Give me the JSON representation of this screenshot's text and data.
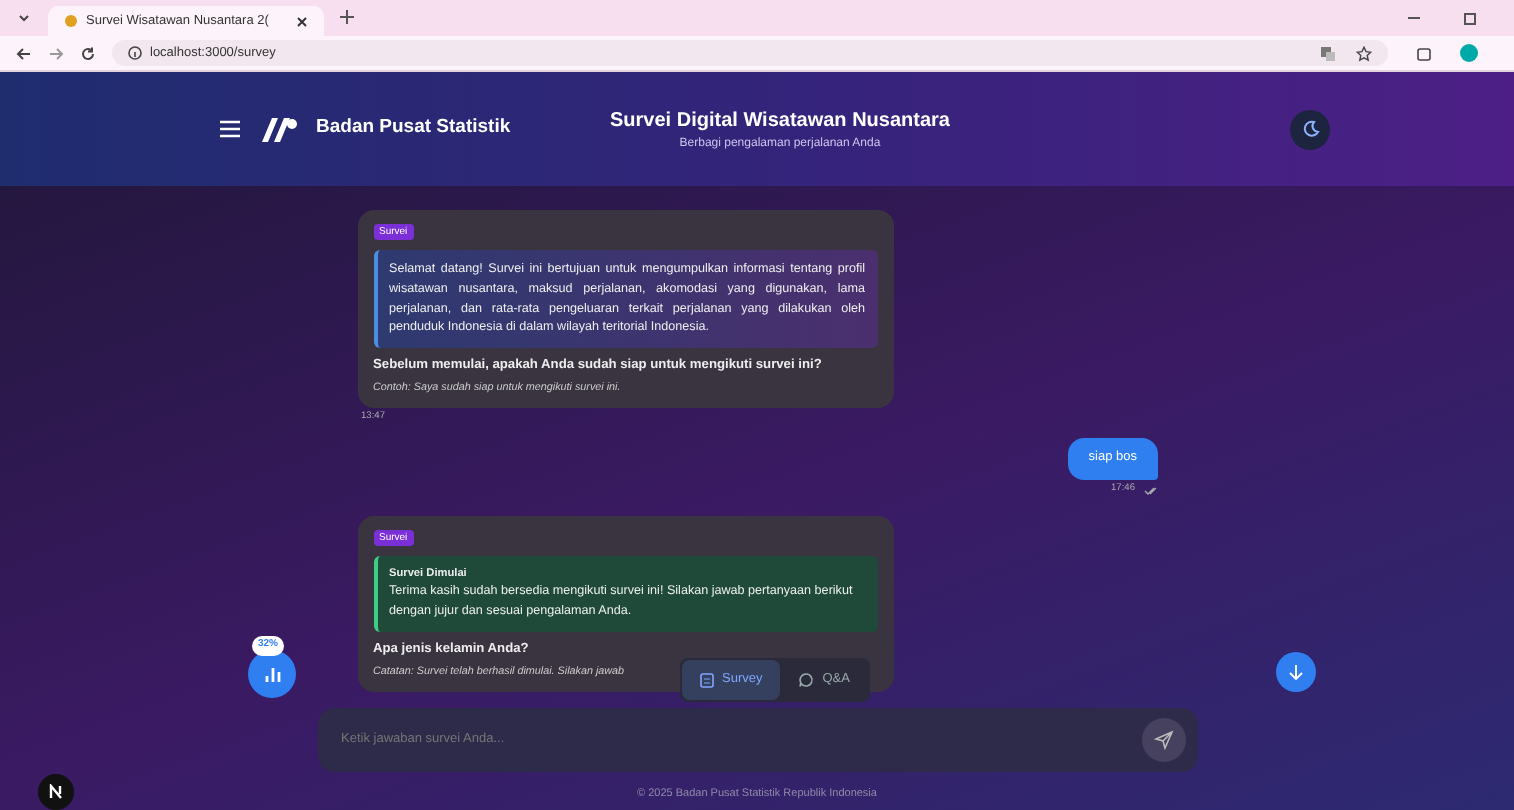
{
  "browser": {
    "tab_title": "Survei Wisatawan Nusantara 2(",
    "address": "localhost:3000/survey"
  },
  "header": {
    "brand": "Badan Pusat Statistik",
    "title": "Survei Digital Wisatawan Nusantara",
    "subtitle": "Berbagi pengalaman perjalanan Anda"
  },
  "messages": [
    {
      "kind": "bot",
      "badge": "Survei",
      "block": {
        "kind": "info",
        "text": "Selamat datang! Survei ini bertujuan untuk mengumpulkan informasi tentang profil wisatawan nusantara, maksud perjalanan, akomodasi yang digunakan, lama perjalanan, dan rata-rata pengeluaran terkait perjalanan yang dilakukan oleh penduduk Indonesia di dalam wilayah teritorial Indonesia."
      },
      "question": "Sebelum memulai, apakah Anda sudah siap untuk mengikuti survei ini?",
      "hint": "Contoh: Saya sudah siap untuk mengikuti survei ini.",
      "time": "13:47"
    },
    {
      "kind": "user",
      "text": "siap bos",
      "time": "17:46"
    },
    {
      "kind": "bot",
      "badge": "Survei",
      "block": {
        "kind": "success",
        "title": "Survei Dimulai",
        "text": "Terima kasih sudah bersedia mengikuti survei ini! Silakan jawab pertanyaan berikut dengan jujur dan sesuai pengalaman Anda."
      },
      "question": "Apa jenis kelamin Anda?",
      "hint": "Catatan: Survei telah berhasil dimulai. Silakan jawab"
    }
  ],
  "mode_tabs": [
    {
      "label": "Survey",
      "selected": true
    },
    {
      "label": "Q&A",
      "selected": false
    }
  ],
  "progress": {
    "label": "32%"
  },
  "input": {
    "placeholder": "Ketik jawaban survei Anda..."
  },
  "footer": "© 2025 Badan Pusat Statistik Republik Indonesia"
}
